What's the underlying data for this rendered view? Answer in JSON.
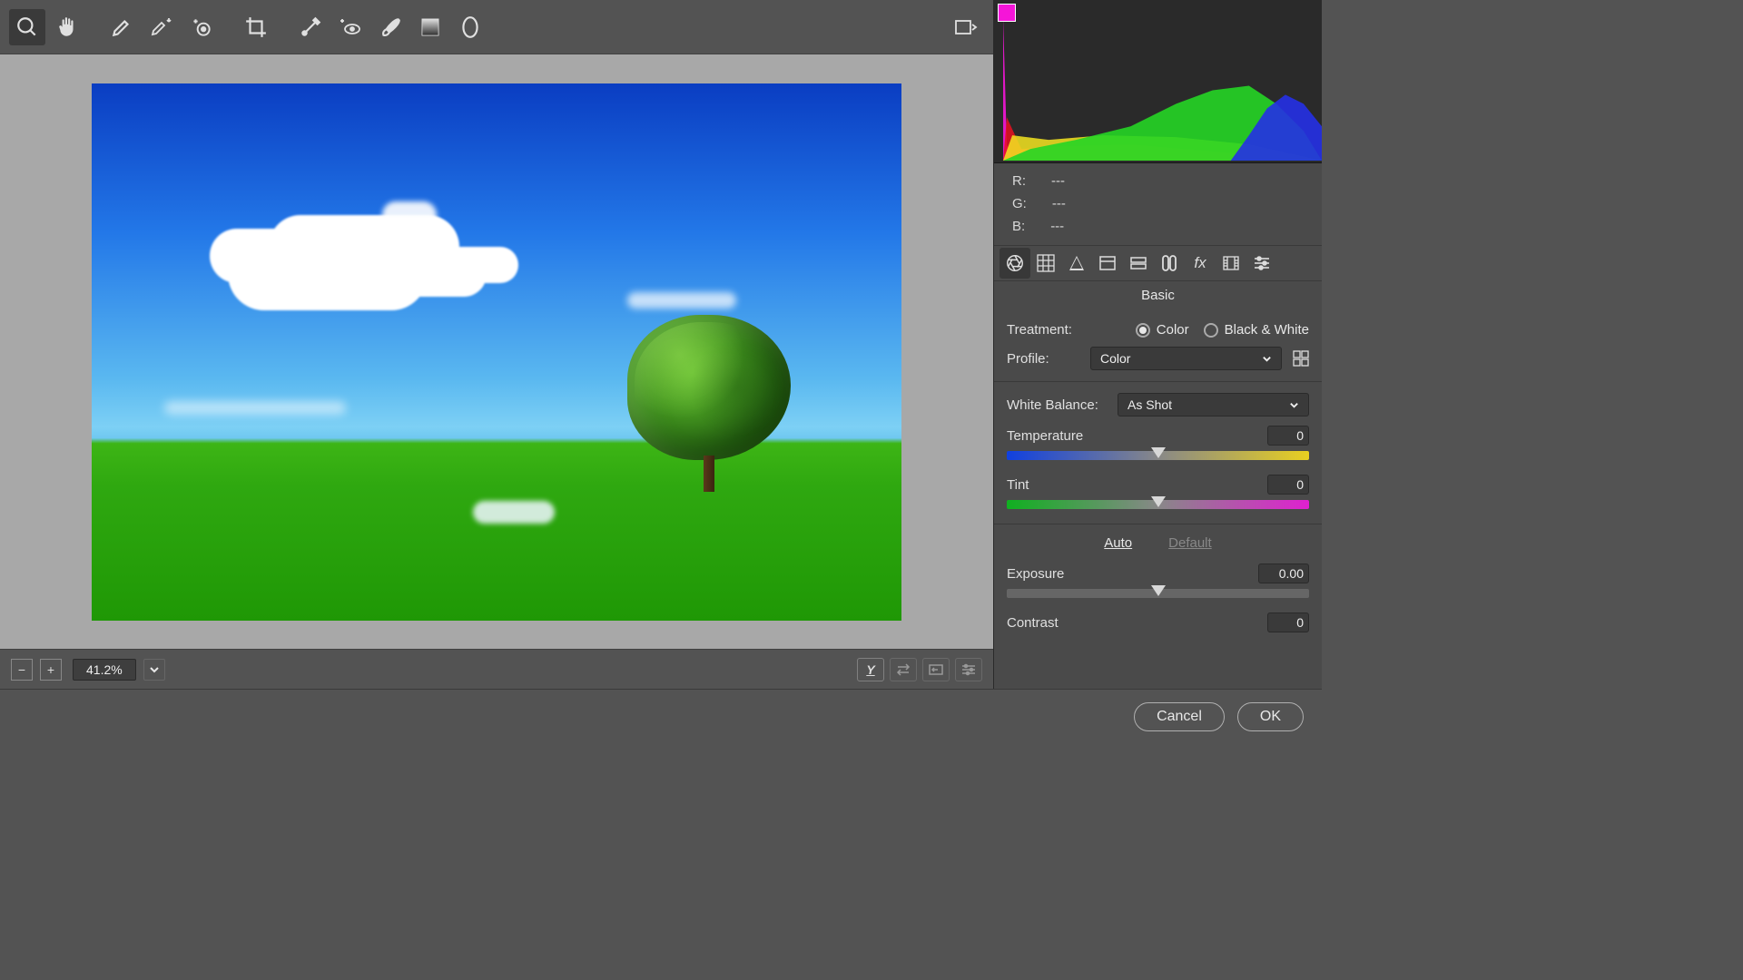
{
  "toolbar": {
    "tools": [
      "zoom",
      "hand",
      "white-balance",
      "color-sampler",
      "target-adjust",
      "crop",
      "spot-removal",
      "red-eye",
      "adjustment-brush",
      "graduated-filter",
      "radial-filter"
    ],
    "active_tool": "zoom",
    "overflow_label": "toggle-panels"
  },
  "bottom_bar": {
    "zoom_out": "−",
    "zoom_in": "+",
    "zoom_value": "41.2%",
    "before_after_label": "Y",
    "nav_prev": "prev",
    "nav_next": "next",
    "prefs": "prefs"
  },
  "rgb_readout": {
    "r_label": "R:",
    "g_label": "G:",
    "b_label": "B:",
    "r_value": "---",
    "g_value": "---",
    "b_value": "---"
  },
  "panel_tabs": [
    "basic",
    "tone-curve",
    "detail",
    "hsl",
    "split-toning",
    "lens",
    "effects",
    "calibration",
    "presets"
  ],
  "panel_tabs_active": "basic",
  "basic_panel": {
    "title": "Basic",
    "treatment_label": "Treatment:",
    "treatment_color": "Color",
    "treatment_bw": "Black & White",
    "treatment_selected": "Color",
    "profile_label": "Profile:",
    "profile_value": "Color",
    "wb_label": "White Balance:",
    "wb_value": "As Shot",
    "temperature_label": "Temperature",
    "temperature_value": "0",
    "tint_label": "Tint",
    "tint_value": "0",
    "auto_label": "Auto",
    "default_label": "Default",
    "exposure_label": "Exposure",
    "exposure_value": "0.00",
    "contrast_label": "Contrast",
    "contrast_value": "0"
  },
  "footer": {
    "cancel": "Cancel",
    "ok": "OK"
  }
}
